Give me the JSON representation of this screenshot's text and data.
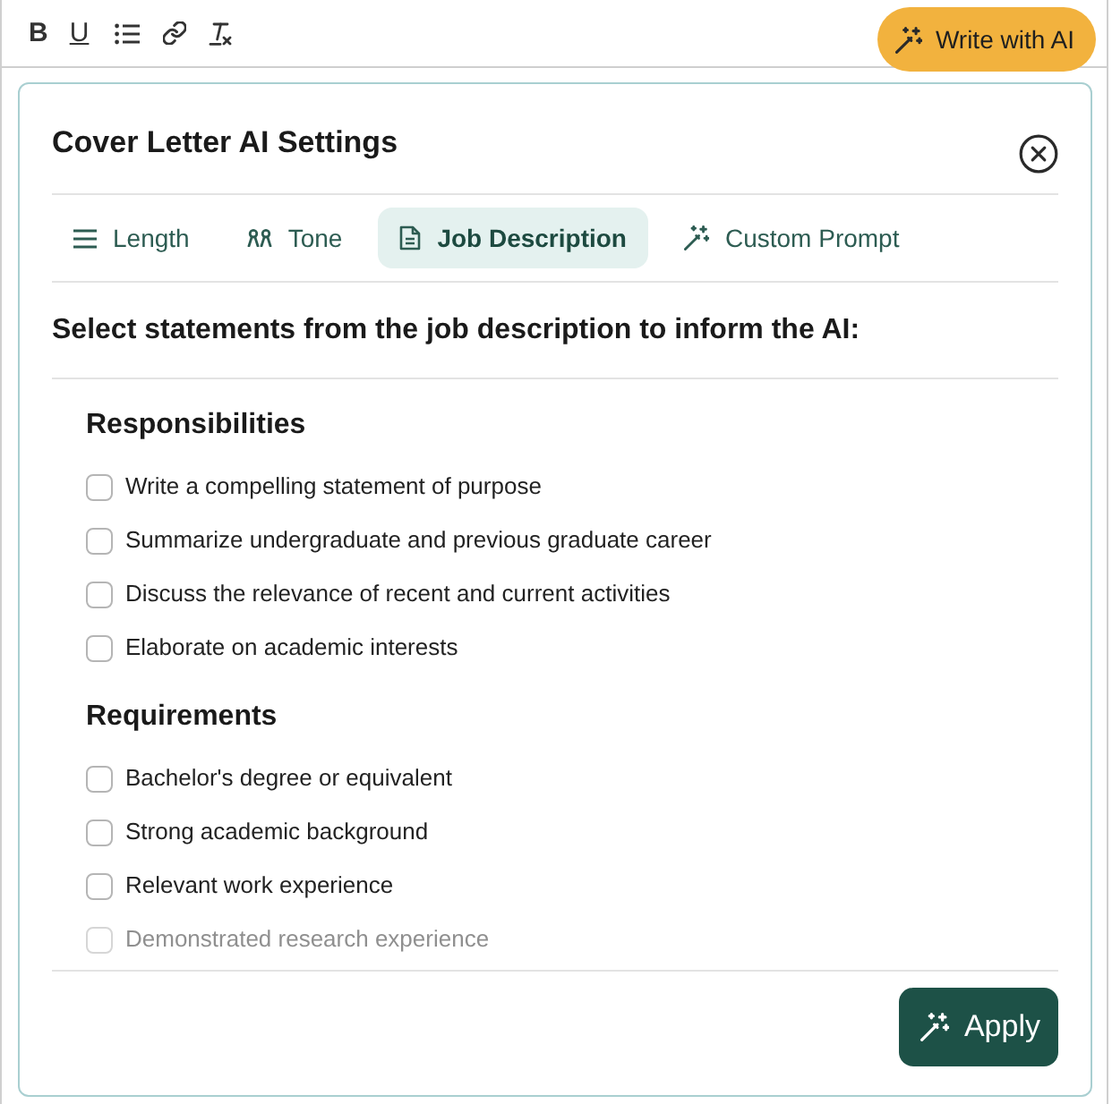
{
  "toolbar": [
    {
      "kind": "bold",
      "label": "B"
    },
    {
      "kind": "underline",
      "label": "U"
    },
    {
      "kind": "bullet_list"
    },
    {
      "kind": "link"
    },
    {
      "kind": "clear_format"
    }
  ],
  "write_button": {
    "label": "Write with AI"
  },
  "panel": {
    "title": "Cover Letter AI Settings",
    "tabs": [
      {
        "label": "Length",
        "kind": "lines",
        "selected": false
      },
      {
        "label": "Tone",
        "kind": "people",
        "selected": false
      },
      {
        "label": "Job Description",
        "kind": "document",
        "selected": true
      },
      {
        "label": "Custom Prompt",
        "kind": "wand",
        "selected": false
      }
    ],
    "instruction": "Select statements from the job description to inform the AI:",
    "sections": [
      {
        "heading": "Responsibilities",
        "items": [
          {
            "label": "Write a compelling statement of purpose",
            "checked": false,
            "faded": false
          },
          {
            "label": "Summarize undergraduate and previous graduate career",
            "checked": false,
            "faded": false
          },
          {
            "label": "Discuss the relevance of recent and current activities",
            "checked": false,
            "faded": false
          },
          {
            "label": "Elaborate on academic interests",
            "checked": false,
            "faded": false
          }
        ]
      },
      {
        "heading": "Requirements",
        "items": [
          {
            "label": "Bachelor's degree or equivalent",
            "checked": false,
            "faded": false
          },
          {
            "label": "Strong academic background",
            "checked": false,
            "faded": false
          },
          {
            "label": "Relevant work experience",
            "checked": false,
            "faded": false
          },
          {
            "label": "Demonstrated research experience",
            "checked": false,
            "faded": true
          }
        ]
      }
    ],
    "apply_button": {
      "label": "Apply"
    }
  }
}
